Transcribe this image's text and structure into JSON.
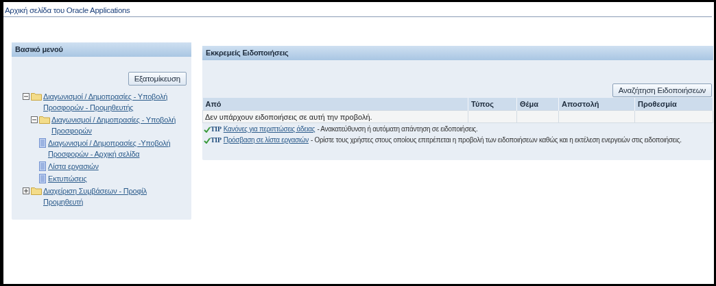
{
  "page_title": "Αρχική σελίδα του Oracle Applications",
  "main_menu": {
    "title": "Βασικό μενού",
    "personalize_button": "Εξατομίκευση",
    "tree": [
      {
        "kind": "folder",
        "label": "Διαγωνισμοί / Δημοπρασίες - Υποβολή Προσφορών - Προμηθευτής",
        "expanded": true,
        "children": [
          {
            "kind": "folder",
            "label": "Διαγωνισμοί / Δημοπρασίες - Υποβολή Προσφορών",
            "expanded": true,
            "children": [
              {
                "kind": "page",
                "label": "Διαγωνισμοί / Δημοπρασίες -Υποβολή Προσφορών - Αρχική σελίδα"
              },
              {
                "kind": "page",
                "label": "Λίστα εργασιών"
              },
              {
                "kind": "page",
                "label": "Εκτυπώσεις"
              }
            ]
          }
        ]
      },
      {
        "kind": "folder",
        "label": "Διαχείριση Συμβάσεων - Προφίλ Προμηθευτή",
        "expanded": false
      }
    ]
  },
  "notifications": {
    "title": "Εκκρεμείς Ειδοποιήσεις",
    "search_button": "Αναζήτηση Ειδοποιήσεων",
    "table": {
      "columns": [
        "Από",
        "Τύπος",
        "Θέμα",
        "Αποστολή",
        "Προθεσμία"
      ],
      "empty_message": "Δεν υπάρχουν ειδοποιήσεις σε αυτή την προβολή."
    },
    "tips": [
      {
        "badge": "TIP",
        "link": "Κανόνες για περιπτώσεις άδειας",
        "text": "- Ανακατεύθυνση ή αυτόματη απάντηση σε ειδοποιήσεις."
      },
      {
        "badge": "TIP",
        "link": "Πρόσβαση σε λίστα εργασιών",
        "text": "- Ορίστε τους χρήστες στους οποίους επιτρέπεται η προβολή των ειδοποιήσεων καθώς και η εκτέλεση ενεργειών στις ειδοποιήσεις."
      }
    ]
  }
}
